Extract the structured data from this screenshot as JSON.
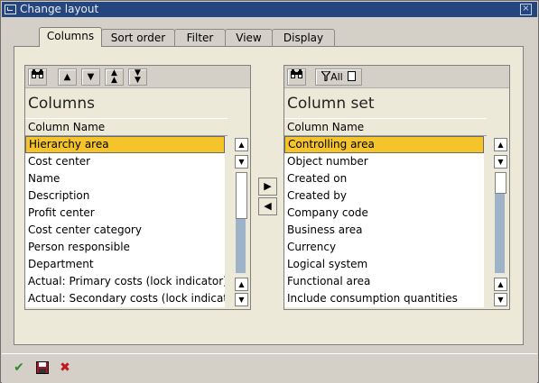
{
  "window": {
    "title": "Change layout"
  },
  "tabs": [
    {
      "label": "Columns",
      "active": true
    },
    {
      "label": "Sort order",
      "active": false
    },
    {
      "label": "Filter",
      "active": false
    },
    {
      "label": "View",
      "active": false
    },
    {
      "label": "Display",
      "active": false
    }
  ],
  "left": {
    "title": "Columns",
    "header": "Column Name",
    "rows": [
      "Hierarchy area",
      "Cost center",
      "Name",
      "Description",
      "Profit center",
      "Cost center category",
      "Person responsible",
      "Department",
      "Actual: Primary costs (lock indicator)",
      "Actual: Secondary costs (lock indicator)"
    ]
  },
  "right": {
    "title": "Column set",
    "header": "Column Name",
    "filter_label": "All",
    "rows": [
      "Controlling area",
      "Object number",
      "Created on",
      "Created by",
      "Company code",
      "Business area",
      "Currency",
      "Logical system",
      "Functional area",
      "Include consumption quantities"
    ]
  },
  "colors": {
    "title_bar": "#24457e",
    "selection": "#f5c428",
    "ok_green": "#2d8a2d",
    "cancel_red": "#c0181e"
  }
}
